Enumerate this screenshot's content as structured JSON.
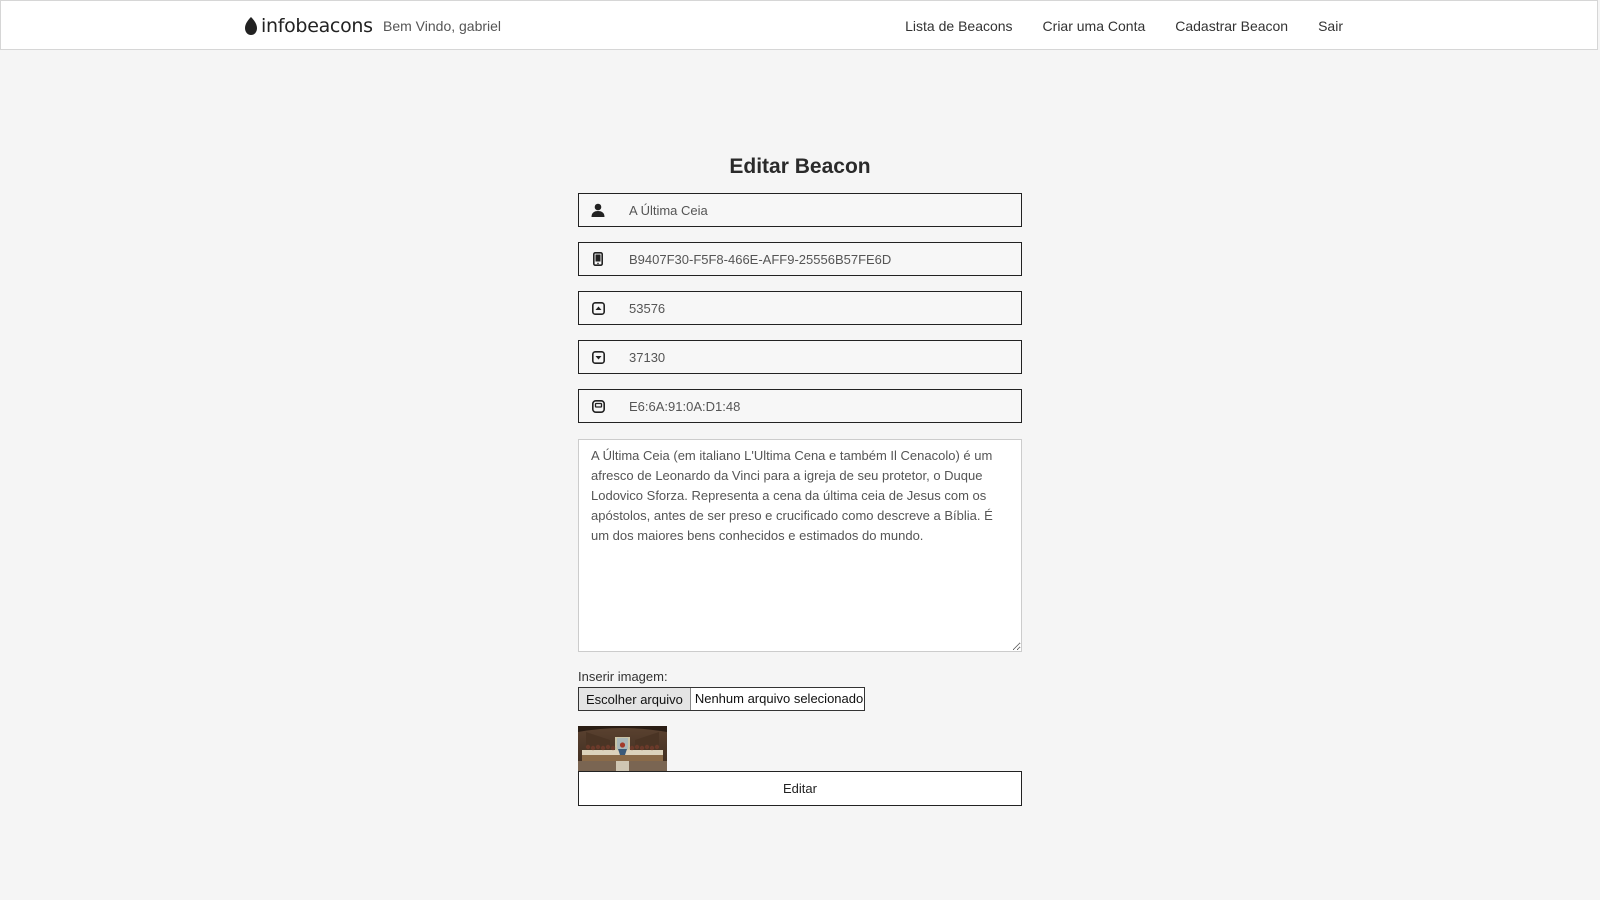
{
  "navbar": {
    "brand": "infobeacons",
    "welcome": "Bem Vindo, gabriel",
    "links": [
      "Lista de Beacons",
      "Criar uma Conta",
      "Cadastrar Beacon",
      "Sair"
    ]
  },
  "form": {
    "title": "Editar Beacon",
    "fields": [
      {
        "icon": "user-icon",
        "value": "A Última Ceia"
      },
      {
        "icon": "mobile-phone-icon",
        "value": "B9407F30-F5F8-466E-AFF9-25556B57FE6D"
      },
      {
        "icon": "caret-square-up-icon",
        "value": "53576"
      },
      {
        "icon": "caret-square-down-icon",
        "value": "37130"
      },
      {
        "icon": "hdd-icon",
        "value": "E6:6A:91:0A:D1:48"
      }
    ],
    "description": "A Última Ceia (em italiano L'Ultima Cena e também Il Cenacolo) é um afresco de Leonardo da Vinci para a igreja de seu protetor, o Duque Lodovico Sforza. Representa a cena da última ceia de Jesus com os apóstolos, antes de ser preso e crucificado como descreve a Bíblia. É um dos maiores bens conhecidos e estimados do mundo.",
    "image_label": "Inserir imagem:",
    "file_button": "Escolher arquivo",
    "file_status": "Nenhum arquivo selecionado",
    "submit": "Editar"
  }
}
